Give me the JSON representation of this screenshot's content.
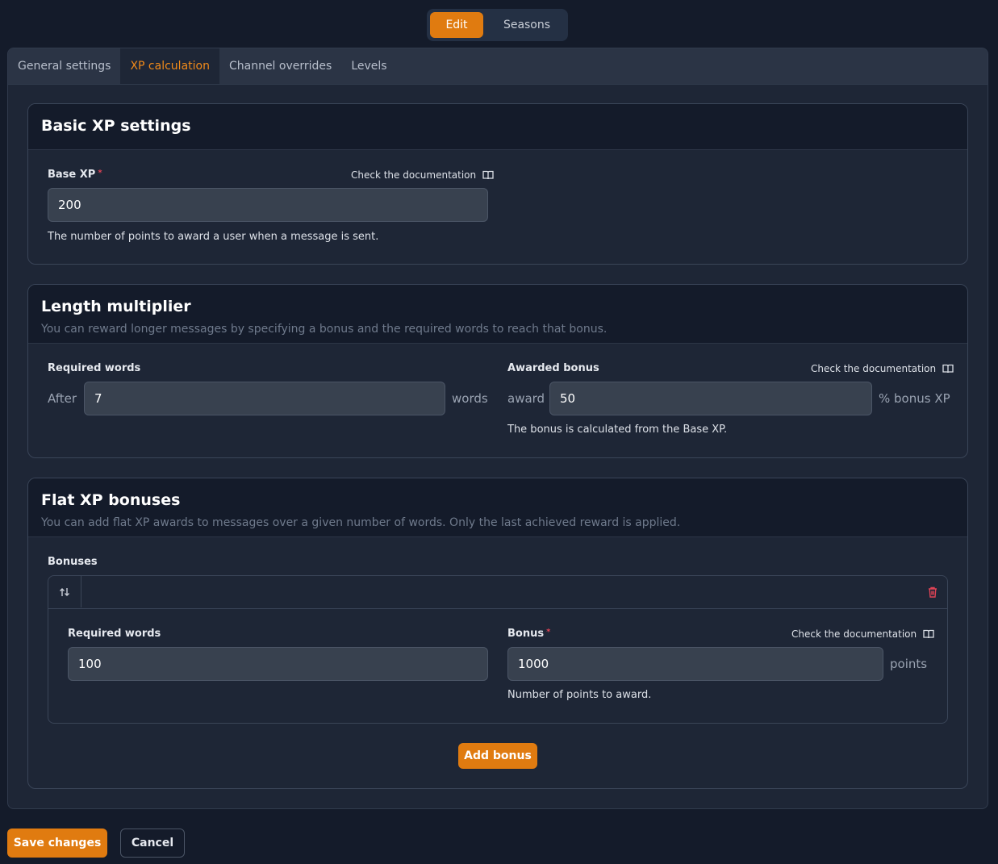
{
  "mode_switch": {
    "edit": "Edit",
    "seasons": "Seasons"
  },
  "tabs": [
    {
      "label": "General settings"
    },
    {
      "label": "XP calculation"
    },
    {
      "label": "Channel overrides"
    },
    {
      "label": "Levels"
    }
  ],
  "doc_link": "Check the documentation",
  "basic": {
    "title": "Basic XP settings",
    "base_xp_label": "Base XP",
    "base_xp_value": "200",
    "base_xp_help": "The number of points to award a user when a message is sent."
  },
  "length": {
    "title": "Length multiplier",
    "subtitle": "You can reward longer messages by specifying a bonus and the required words to reach that bonus.",
    "required_words_label": "Required words",
    "prefix_after": "After",
    "required_words_value": "7",
    "suffix_words": "words",
    "awarded_bonus_label": "Awarded bonus",
    "prefix_award": "award",
    "awarded_bonus_value": "50",
    "suffix_bonus": "% bonus XP",
    "awarded_bonus_help": "The bonus is calculated from the Base XP."
  },
  "flat": {
    "title": "Flat XP bonuses",
    "subtitle": "You can add flat XP awards to messages over a given number of words. Only the last achieved reward is applied.",
    "bonuses_label": "Bonuses",
    "item": {
      "required_words_label": "Required words",
      "required_words_value": "100",
      "bonus_label": "Bonus",
      "bonus_value": "1000",
      "suffix_points": "points",
      "bonus_help": "Number of points to award."
    },
    "add_bonus": "Add bonus"
  },
  "footer": {
    "save": "Save changes",
    "cancel": "Cancel"
  },
  "colors": {
    "accent": "#e07b10",
    "danger": "#e04356",
    "background": "#141b2a"
  },
  "icons": {
    "doc": "book-icon",
    "reorder": "reorder-arrows-icon",
    "delete": "trash-icon"
  }
}
